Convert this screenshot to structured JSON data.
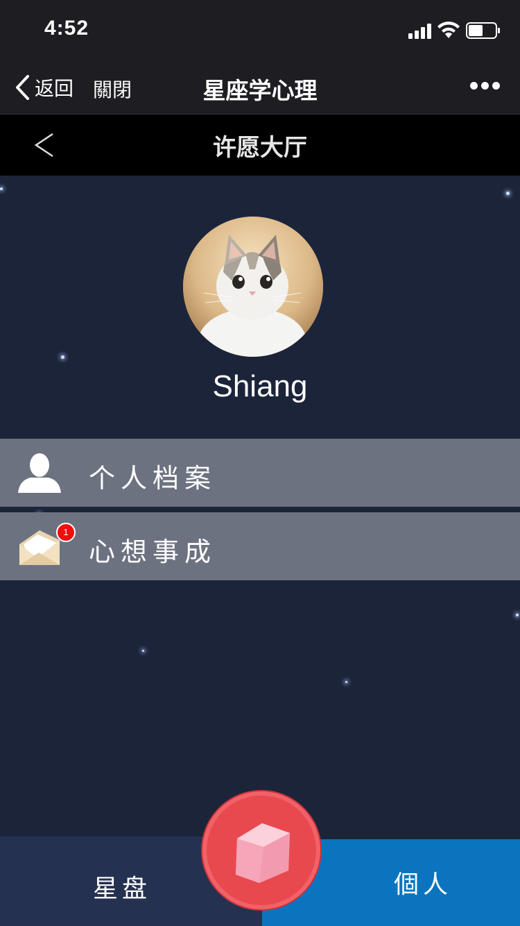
{
  "status_bar": {
    "time": "4:52",
    "icons": [
      "signal-icon",
      "wifi-icon",
      "battery-icon"
    ]
  },
  "nav_bar": {
    "back_label": "返回",
    "close_label": "關閉",
    "title": "星座学心理",
    "more_icon": "more-dots-icon"
  },
  "page_header": {
    "back_icon": "chevron-left-icon",
    "title": "许愿大厅"
  },
  "profile": {
    "username": "Shiang",
    "avatar": "cat-avatar"
  },
  "menu": {
    "items": [
      {
        "label": "个人档案",
        "icon": "user-icon"
      },
      {
        "label": "心想事成",
        "icon": "envelope-icon",
        "badge": "1"
      }
    ]
  },
  "tab_bar": {
    "left_label": "星盘",
    "right_label": "個人",
    "center_icon": "gem-icon"
  },
  "colors": {
    "background": "#1c2439",
    "menu_item": "#6c7280",
    "tab_left": "#243150",
    "tab_right": "#0a75be",
    "center_button": "#e8494f",
    "badge": "#f20d0d"
  }
}
